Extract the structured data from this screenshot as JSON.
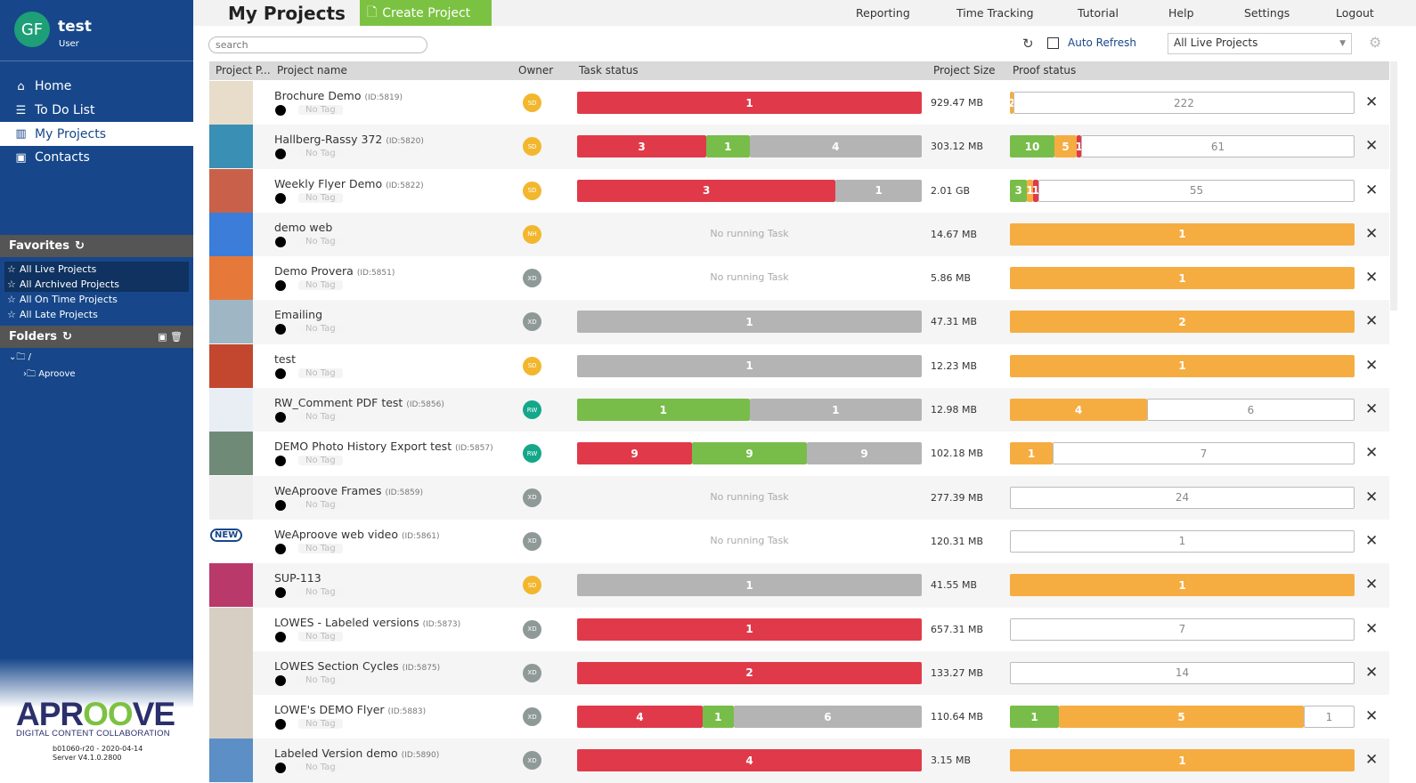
{
  "user": {
    "initials": "GF",
    "name": "test",
    "role": "User"
  },
  "nav": [
    {
      "label": "Home",
      "icon": "home-icon",
      "glyph": "⌂"
    },
    {
      "label": "To Do List",
      "icon": "list-icon",
      "glyph": "☰"
    },
    {
      "label": "My Projects",
      "icon": "projects-icon",
      "glyph": "▥",
      "active": true
    },
    {
      "label": "Contacts",
      "icon": "contacts-icon",
      "glyph": "▣"
    }
  ],
  "favorites": {
    "title": "Favorites",
    "items": [
      {
        "label": "All Live Projects",
        "sel": true
      },
      {
        "label": "All Archived Projects",
        "sel": true
      },
      {
        "label": "All On Time Projects"
      },
      {
        "label": "All Late Projects"
      }
    ]
  },
  "folders": {
    "title": "Folders",
    "root": "/",
    "child": "Aproove"
  },
  "logo": {
    "text": "APROOVE",
    "tagline": "DIGITAL CONTENT COLLABORATION"
  },
  "build": {
    "line1": "b01060-r20 - 2020-04-14",
    "line2": "Server V4.1.0.2800"
  },
  "header": {
    "title": "My Projects",
    "create": "Create Project",
    "menu": [
      "Reporting",
      "Time Tracking",
      "Tutorial",
      "Help",
      "Settings",
      "Logout"
    ]
  },
  "toolbar": {
    "search_placeholder": "search",
    "auto_refresh": "Auto Refresh",
    "filter": "All Live Projects"
  },
  "columns": {
    "preview": "Project P...",
    "name": "Project name",
    "owner": "Owner",
    "task": "Task status",
    "size": "Project Size",
    "proof": "Proof status"
  },
  "colors": {
    "red": "#e03a4a",
    "green": "#78bd4a",
    "gray": "#b4b4b4",
    "orange": "#f5ad42",
    "sd": "#f2b72e",
    "xd": "#8f9a98",
    "rw": "#14a78a",
    "nh": "#f2b72e"
  },
  "no_task": "No running Task",
  "no_tag": "No Tag",
  "new_badge": "NEW",
  "projects": [
    {
      "name": "Brochure Demo",
      "id": "(ID:5819)",
      "owner": "SD",
      "task": [
        [
          "red",
          1
        ]
      ],
      "size": "929.47 MB",
      "proof": [
        [
          "orange",
          2
        ],
        [
          "none",
          222
        ]
      ],
      "thumb": "#e8dccb"
    },
    {
      "name": "Hallberg-Rassy 372",
      "id": "(ID:5820)",
      "owner": "SD",
      "task": [
        [
          "red",
          3
        ],
        [
          "green",
          1
        ],
        [
          "gray",
          4
        ]
      ],
      "size": "303.12 MB",
      "proof": [
        [
          "green",
          10
        ],
        [
          "orange",
          5
        ],
        [
          "red",
          1
        ],
        [
          "none",
          61
        ]
      ],
      "thumb": "#3a8fb5"
    },
    {
      "name": "Weekly Flyer Demo",
      "id": "(ID:5822)",
      "owner": "SD",
      "task": [
        [
          "red",
          3
        ],
        [
          "gray",
          1
        ]
      ],
      "size": "2.01 GB",
      "proof": [
        [
          "green",
          3
        ],
        [
          "orange",
          1
        ],
        [
          "red",
          1
        ],
        [
          "none",
          55
        ]
      ],
      "thumb": "#c9614a"
    },
    {
      "name": "demo web",
      "id": "",
      "owner": "NH",
      "task": [],
      "size": "14.67 MB",
      "proof": [
        [
          "orange",
          1
        ]
      ],
      "thumb": "#3b7dd8"
    },
    {
      "name": "Demo Provera",
      "id": "(ID:5851)",
      "owner": "XD",
      "task": [],
      "size": "5.86 MB",
      "proof": [
        [
          "orange",
          1
        ]
      ],
      "thumb": "#e6793a"
    },
    {
      "name": "Emailing",
      "id": "",
      "owner": "XD",
      "task": [
        [
          "gray",
          1
        ]
      ],
      "size": "47.31 MB",
      "proof": [
        [
          "orange",
          2
        ]
      ],
      "thumb": "#9fb7c4"
    },
    {
      "name": "test",
      "id": "",
      "owner": "SD",
      "task": [
        [
          "gray",
          1
        ]
      ],
      "size": "12.23 MB",
      "proof": [
        [
          "orange",
          1
        ]
      ],
      "thumb": "#c2472e"
    },
    {
      "name": "RW_Comment PDF test",
      "id": "(ID:5856)",
      "owner": "RW",
      "task": [
        [
          "green",
          1
        ],
        [
          "gray",
          1
        ]
      ],
      "size": "12.98 MB",
      "proof": [
        [
          "orange",
          4
        ],
        [
          "none",
          6
        ]
      ],
      "thumb": "#e9eef5"
    },
    {
      "name": "DEMO Photo History Export test",
      "id": "(ID:5857)",
      "owner": "RW",
      "task": [
        [
          "red",
          9
        ],
        [
          "green",
          9
        ],
        [
          "gray",
          9
        ]
      ],
      "size": "102.18 MB",
      "proof": [
        [
          "orange",
          1
        ],
        [
          "none",
          7
        ]
      ],
      "thumb": "#6f8b78"
    },
    {
      "name": "WeAproove Frames",
      "id": "(ID:5859)",
      "owner": "XD",
      "task": [],
      "size": "277.39 MB",
      "proof": [
        [
          "none",
          24
        ]
      ],
      "thumb": "#eeeeee"
    },
    {
      "name": "WeAproove web video",
      "id": "(ID:5861)",
      "owner": "XD",
      "task": [],
      "size": "120.31 MB",
      "proof": [
        [
          "none",
          1
        ]
      ],
      "thumb": "",
      "is_new": true
    },
    {
      "name": "SUP-113",
      "id": "",
      "owner": "SD",
      "task": [
        [
          "gray",
          1
        ]
      ],
      "size": "41.55 MB",
      "proof": [
        [
          "orange",
          1
        ]
      ],
      "thumb": "#b8396a"
    },
    {
      "name": "LOWES - Labeled versions",
      "id": "(ID:5873)",
      "owner": "XD",
      "task": [
        [
          "red",
          1
        ]
      ],
      "size": "657.31 MB",
      "proof": [
        [
          "none",
          7
        ]
      ],
      "thumb": "#d8cfc4"
    },
    {
      "name": "LOWES Section Cycles",
      "id": "(ID:5875)",
      "owner": "XD",
      "task": [
        [
          "red",
          2
        ]
      ],
      "size": "133.27 MB",
      "proof": [
        [
          "none",
          14
        ]
      ],
      "thumb": "#d8cfc4"
    },
    {
      "name": "LOWE's DEMO Flyer",
      "id": "(ID:5883)",
      "owner": "XD",
      "task": [
        [
          "red",
          4
        ],
        [
          "green",
          1
        ],
        [
          "gray",
          6
        ]
      ],
      "size": "110.64 MB",
      "proof": [
        [
          "green",
          1
        ],
        [
          "orange",
          5
        ],
        [
          "none",
          1
        ]
      ],
      "thumb": "#d8cfc4"
    },
    {
      "name": "Labeled Version demo",
      "id": "(ID:5890)",
      "owner": "XD",
      "task": [
        [
          "red",
          4
        ]
      ],
      "size": "3.15 MB",
      "proof": [
        [
          "orange",
          1
        ]
      ],
      "thumb": "#5b8fc5"
    }
  ]
}
